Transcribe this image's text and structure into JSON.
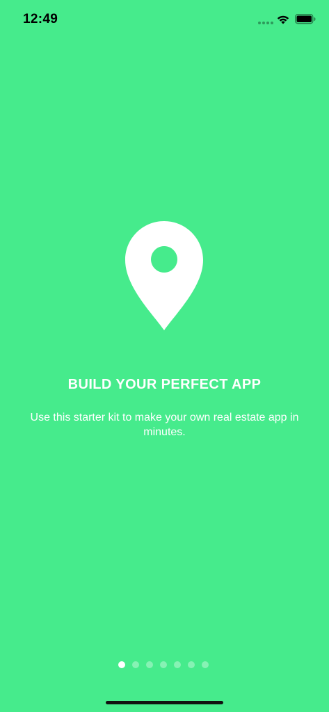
{
  "status_bar": {
    "time": "12:49",
    "icons": [
      "signal-dots-icon",
      "wifi-icon",
      "battery-icon"
    ]
  },
  "onboarding": {
    "icon": "map-pin-icon",
    "title": "BUILD YOUR PERFECT APP",
    "subtitle": "Use this starter kit to make your own real estate app in minutes."
  },
  "pagination": {
    "total": 7,
    "active_index": 0
  },
  "colors": {
    "background": "#46eb8c",
    "foreground": "#ffffff"
  }
}
